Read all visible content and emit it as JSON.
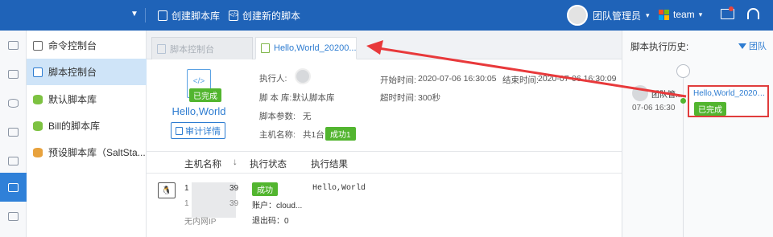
{
  "topbar": {
    "create_library": "创建脚本库",
    "create_script": "创建新的脚本",
    "user_name": "团队管理员",
    "team_label": "team",
    "colors": {
      "background": "#1f63b8"
    }
  },
  "sidebar": {
    "items": [
      {
        "label": "命令控制台",
        "icon": "terminal-icon"
      },
      {
        "label": "脚本控制台",
        "icon": "code-icon"
      },
      {
        "label": "默认脚本库",
        "icon": "database-icon"
      },
      {
        "label": "Bill的脚本库",
        "icon": "database-icon"
      },
      {
        "label": "预设脚本库（SaltSta...",
        "icon": "database-icon"
      }
    ]
  },
  "tabs": [
    {
      "label": "脚本控制台",
      "state": "inactive"
    },
    {
      "label": "Hello,World_20200...",
      "state": "active"
    }
  ],
  "script": {
    "status_badge": "已完成",
    "name": "Hello,World",
    "audit_button": "审计详情",
    "executor_label": "执行人:",
    "library_label": "脚 本 库:",
    "library_value": "默认脚本库",
    "params_label": "脚本参数:",
    "params_value": "无",
    "hosts_label": "主机名称:",
    "hosts_value": "共1台",
    "success_badge": "成功1",
    "start_label": "开始时间:",
    "start_value": "2020-07-06 16:30:05",
    "end_label": "结束时间:",
    "end_value": "2020-07-06 16:30:09",
    "timeout_label": "超时时间:",
    "timeout_value": "300秒"
  },
  "table": {
    "headers": [
      "主机名称",
      "执行状态",
      "执行结果"
    ],
    "sort_icon": "↓",
    "row": {
      "ip1_prefix": "1",
      "ip1_suffix": "39",
      "ip2_prefix": "1",
      "ip2_suffix": "39",
      "network": "无内网IP",
      "status": "成功",
      "account": "账户：cloud...",
      "exit_code": "退出码：0",
      "result": "Hello,World"
    }
  },
  "history": {
    "title": "脚本执行历史:",
    "filter_label": "团队",
    "user": "团队管...",
    "time": "07-06 16:30",
    "script_link": "Hello,World_20200...",
    "status_badge": "已完成"
  }
}
